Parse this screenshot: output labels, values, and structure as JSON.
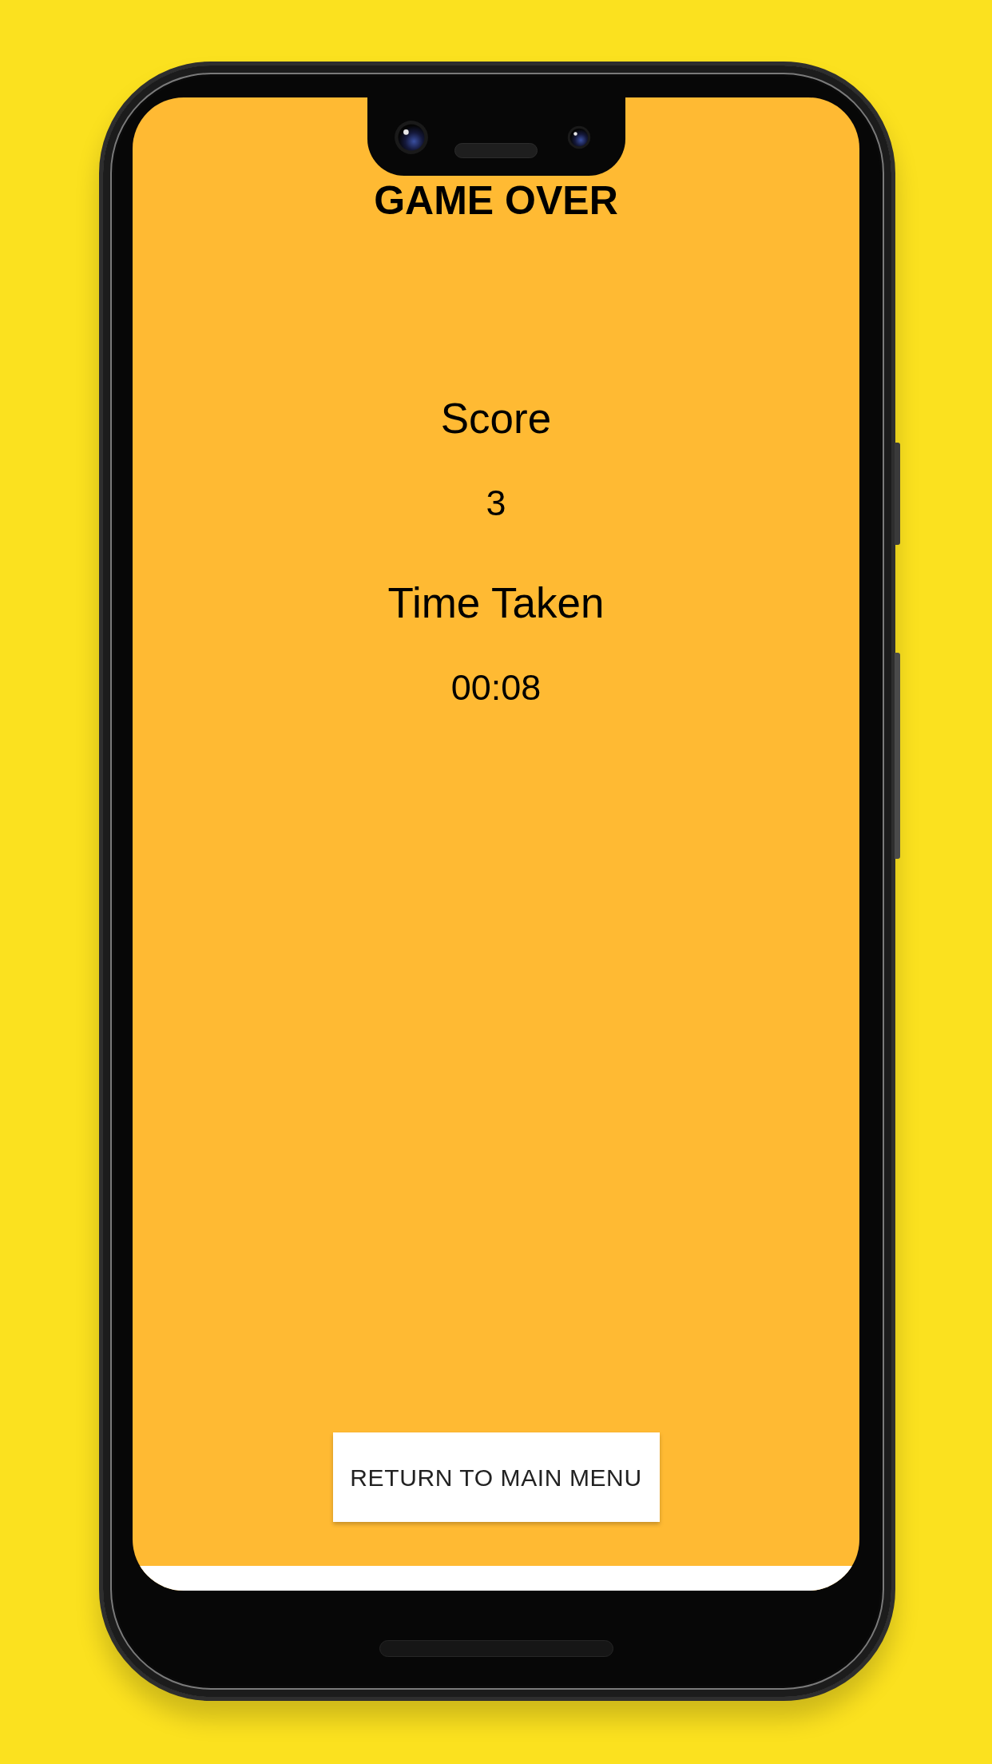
{
  "screen": {
    "title": "GAME OVER",
    "stats": [
      {
        "label": "Score",
        "value": "3"
      },
      {
        "label": "Time Taken",
        "value": "00:08"
      }
    ],
    "button": {
      "label": "RETURN TO MAIN MENU"
    }
  }
}
